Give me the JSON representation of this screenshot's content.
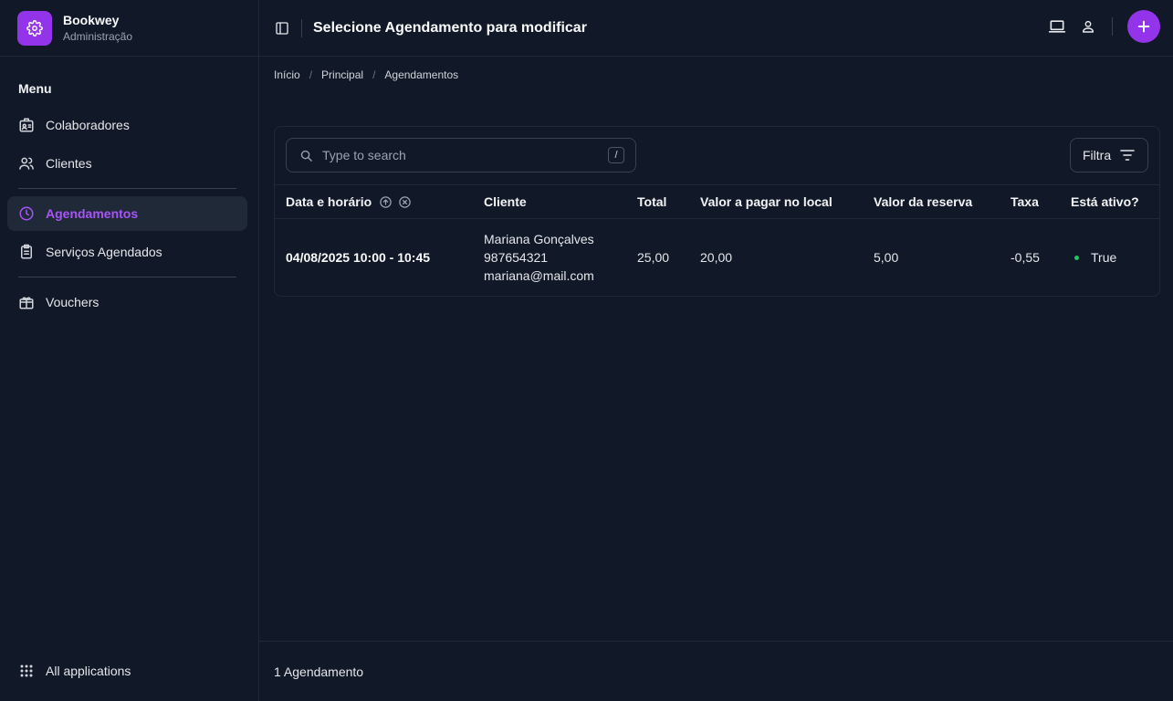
{
  "brand": {
    "name": "Bookwey",
    "subtitle": "Administração"
  },
  "sidebar": {
    "heading": "Menu",
    "items": [
      {
        "label": "Colaboradores",
        "icon": "id-card-icon",
        "active": false
      },
      {
        "label": "Clientes",
        "icon": "users-icon",
        "active": false
      },
      {
        "label": "Agendamentos",
        "icon": "clock-icon",
        "active": true
      },
      {
        "label": "Serviços Agendados",
        "icon": "clipboard-list-icon",
        "active": false
      },
      {
        "label": "Vouchers",
        "icon": "gift-icon",
        "active": false
      }
    ],
    "footer_item": {
      "label": "All applications",
      "icon": "grid-icon"
    }
  },
  "header": {
    "title": "Selecione Agendamento para modificar"
  },
  "breadcrumb": [
    "Início",
    "Principal",
    "Agendamentos"
  ],
  "search": {
    "placeholder": "Type to search",
    "shortcut": "/"
  },
  "filter": {
    "label": "Filtra"
  },
  "table": {
    "columns": [
      "Data e horário",
      "Cliente",
      "Total",
      "Valor a pagar no local",
      "Valor da reserva",
      "Taxa",
      "Está ativo?"
    ],
    "rows": [
      {
        "date_time": "04/08/2025 10:00 - 10:45",
        "client_name": "Mariana Gonçalves",
        "client_phone": "987654321",
        "client_email": "mariana@mail.com",
        "total": "25,00",
        "pay_on_site": "20,00",
        "reservation_value": "5,00",
        "fee": "-0,55",
        "active": "True"
      }
    ]
  },
  "footer": {
    "count_text": "1 Agendamento"
  },
  "colors": {
    "accent": "#9333ea",
    "accent_text": "#a855f7",
    "background": "#111827",
    "status_active": "#22c55e"
  }
}
